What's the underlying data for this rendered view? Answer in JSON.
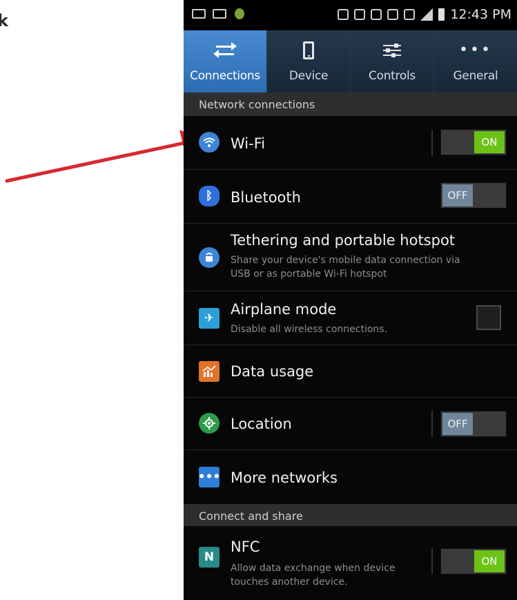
{
  "corner_text": "k",
  "annotation": {
    "arrow_color": "#d42a2f",
    "points_to": "Wi-Fi"
  },
  "status_bar": {
    "time": "12:43 PM"
  },
  "tabs": [
    {
      "label": "Connections",
      "icon": "swap-arrows-icon",
      "active": true
    },
    {
      "label": "Device",
      "icon": "phone-icon",
      "active": false
    },
    {
      "label": "Controls",
      "icon": "sliders-icon",
      "active": false
    },
    {
      "label": "General",
      "icon": "more-dots-icon",
      "active": false
    }
  ],
  "sections": {
    "network": "Network connections",
    "share": "Connect and share"
  },
  "items": {
    "wifi": {
      "title": "Wi-Fi",
      "toggle": "ON",
      "icon": "wifi-icon",
      "color": "#3e84d8"
    },
    "bluetooth": {
      "title": "Bluetooth",
      "toggle": "OFF",
      "icon": "bluetooth-icon",
      "color": "#2e6fd9"
    },
    "tethering": {
      "title": "Tethering and portable hotspot",
      "subtitle_line1": "Share your device's mobile data connection via",
      "subtitle_line2": "USB or as portable Wi-Fi hotspot",
      "icon": "hotspot-icon",
      "color": "#3b86d8"
    },
    "airplane": {
      "title": "Airplane mode",
      "subtitle": "Disable all wireless connections.",
      "checked": false,
      "icon": "airplane-icon",
      "color": "#2b9fd6"
    },
    "data_usage": {
      "title": "Data usage",
      "icon": "data-usage-icon",
      "color": "#e2732a"
    },
    "location": {
      "title": "Location",
      "toggle": "OFF",
      "icon": "location-icon",
      "color": "#2f9b4a"
    },
    "more_networks": {
      "title": "More networks",
      "icon": "more-networks-icon",
      "color": "#2f7fd6"
    },
    "nfc": {
      "title": "NFC",
      "subtitle_line1": "Allow data exchange when device",
      "subtitle_line2": "touches another device.",
      "toggle": "ON",
      "icon": "nfc-icon",
      "color": "#2a8a8a"
    }
  }
}
